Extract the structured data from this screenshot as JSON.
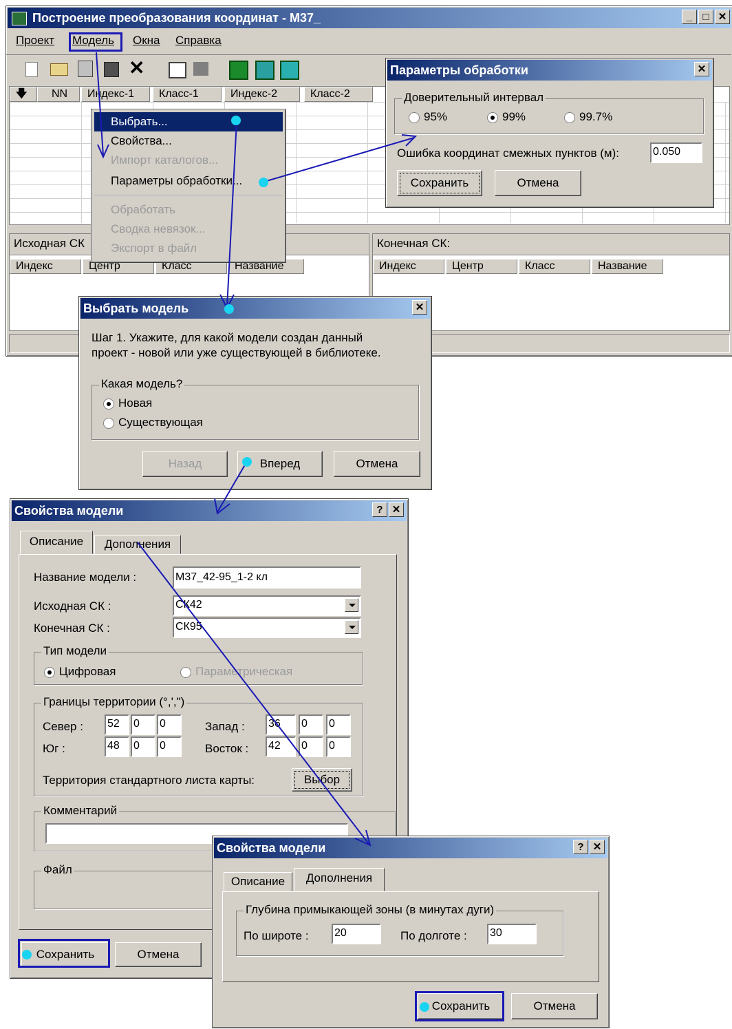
{
  "main_window": {
    "title": "Построение преобразования координат - М37_",
    "menu": [
      "Проект",
      "Модель",
      "Окна",
      "Справка"
    ],
    "grid_headers": [
      "NN",
      "Индекс-1",
      "Класс-1",
      "Индекс-2",
      "Класс-2"
    ],
    "source_panel_label": "Исходная СК",
    "target_panel_label": "Конечная СК:",
    "panel_headers": [
      "Индекс",
      "Центр",
      "Класс",
      "Название"
    ]
  },
  "model_menu": {
    "items": [
      {
        "label": "Выбрать...",
        "enabled": true
      },
      {
        "label": "Свойства...",
        "enabled": true
      },
      {
        "label": "Импорт каталогов...",
        "enabled": false
      },
      {
        "label": "Параметры обработки...",
        "enabled": true
      },
      {
        "label": "Обработать",
        "enabled": false
      },
      {
        "label": "Сводка невязок...",
        "enabled": false
      },
      {
        "label": "Экспорт в файл",
        "enabled": false
      }
    ]
  },
  "params_dialog": {
    "title": "Параметры обработки",
    "group_label": "Доверительный интервал",
    "options": [
      "95%",
      "99%",
      "99.7%"
    ],
    "selected": "99%",
    "error_label": "Ошибка координат смежных пунктов (м):",
    "error_value": "0.050",
    "save_label": "Сохранить",
    "cancel_label": "Отмена"
  },
  "select_dialog": {
    "title": "Выбрать модель",
    "step_text_1": "Шаг 1. Укажите, для какой модели создан данный",
    "step_text_2": "проект - новой или уже существующей в библиотеке.",
    "group_label": "Какая модель?",
    "option_new": "Новая",
    "option_existing": "Существующая",
    "back_label": "Назад",
    "next_label": "Вперед",
    "cancel_label": "Отмена"
  },
  "props_dialog": {
    "title": "Свойства модели",
    "tab_description": "Описание",
    "tab_additions": "Дополнения",
    "name_label": "Название модели :",
    "name_value": "М37_42-95_1-2 кл",
    "source_label": "Исходная СК :",
    "source_value": "СК42",
    "target_label": "Конечная СК :",
    "target_value": "СК95",
    "type_group": "Тип модели",
    "type_digital": "Цифровая",
    "type_parametric": "Параметрическая",
    "bounds_group": "Границы территории (°,',\")",
    "north_label": "Север :",
    "north": [
      "52",
      "0",
      "0"
    ],
    "south_label": "Юг :",
    "south": [
      "48",
      "0",
      "0"
    ],
    "west_label": "Запад :",
    "west": [
      "36",
      "0",
      "0"
    ],
    "east_label": "Восток :",
    "east": [
      "42",
      "0",
      "0"
    ],
    "sheet_label": "Территория стандартного листа карты:",
    "choose_label": "Выбор",
    "comment_group": "Комментарий",
    "file_group": "Файл",
    "save_label": "Сохранить",
    "cancel_label": "Отмена"
  },
  "props_dialog2": {
    "title": "Свойства модели",
    "tab_description": "Описание",
    "tab_additions": "Дополнения",
    "depth_group": "Глубина примыкающей зоны (в минутах дуги)",
    "lat_label": "По широте :",
    "lat_value": "20",
    "lon_label": "По долготе :",
    "lon_value": "30",
    "save_label": "Сохранить",
    "cancel_label": "Отмена"
  },
  "colors": {
    "title_start": "#0a246a",
    "title_end": "#a6caf0",
    "annotation_arrow": "#1a1ab4",
    "annotation_dot": "#19d4f0"
  }
}
